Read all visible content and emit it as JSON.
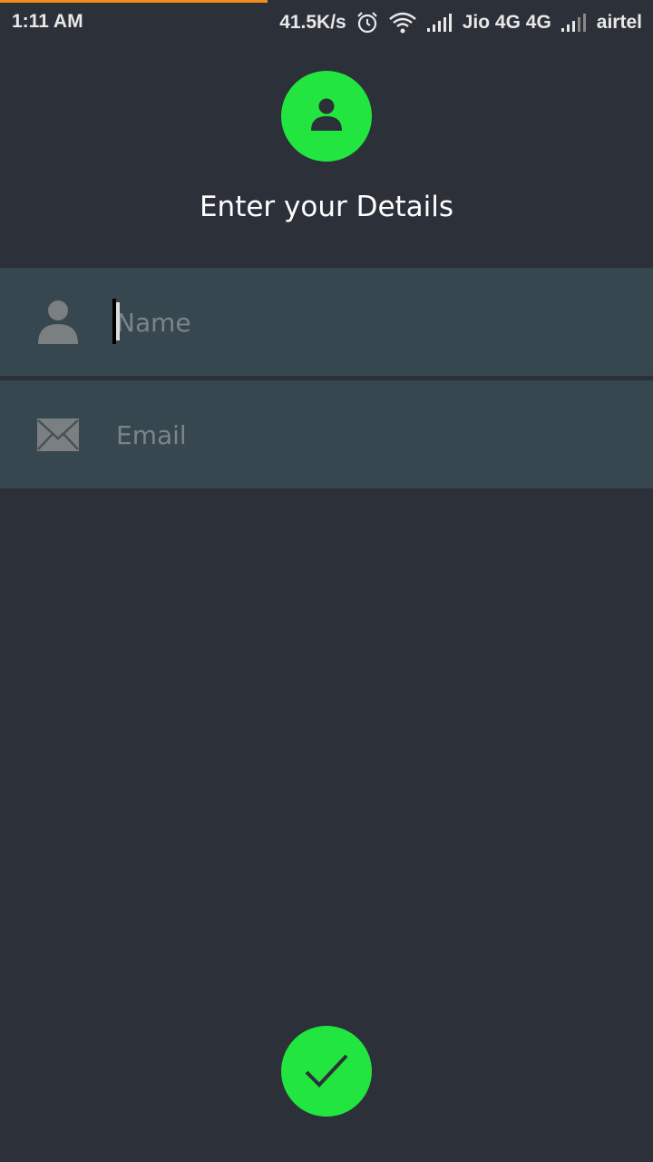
{
  "status_bar": {
    "time": "1:11 AM",
    "speed": "41.5K/s",
    "carrier1": "Jio 4G 4G",
    "carrier2": "airtel",
    "icons": [
      "alarm-icon",
      "wifi-icon",
      "signal-icon",
      "signal-icon"
    ]
  },
  "header": {
    "title": "Enter your Details",
    "icon": "person-icon"
  },
  "form": {
    "name": {
      "placeholder": "Name",
      "value": "",
      "icon": "person-icon"
    },
    "email": {
      "placeholder": "Email",
      "value": "",
      "icon": "mail-icon"
    }
  },
  "submit": {
    "icon": "checkmark-icon"
  },
  "colors": {
    "accent": "#22e63f",
    "background": "#2c3038",
    "field_background": "#37474f",
    "progress": "#f28c1c"
  }
}
